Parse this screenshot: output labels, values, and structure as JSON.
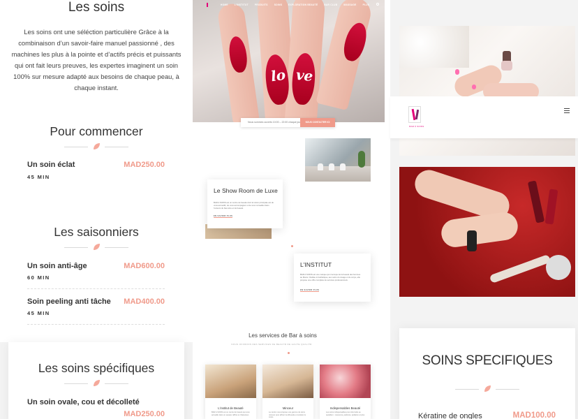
{
  "left": {
    "title": "Les soins",
    "intro": "Les soins ont une séléction particulière Grâce à la combinaison d’un savoir-faire manuel passionné , des machines les plus à la pointe et d’actifs précis et puissants qui ont fait leurs preuves, les expertes imaginent un soin 100% sur mesure adapté aux besoins de chaque peau, à chaque instant.",
    "sections": [
      {
        "title": "Pour commencer",
        "items": [
          {
            "name": "Un soin éclat",
            "price": "MAD250.00",
            "duration": "45 MIN"
          }
        ]
      },
      {
        "title": "Les saisonniers",
        "items": [
          {
            "name": "Un soin anti-âge",
            "price": "MAD600.00",
            "duration": "60 MIN"
          },
          {
            "name": "Soin peeling anti tâche",
            "price": "MAD400.00",
            "duration": "45 MIN"
          }
        ]
      },
      {
        "title": "Les soins spécifiques",
        "items": [
          {
            "name": "Un soin ovale, cou et décolleté",
            "price": "MAD250.00"
          }
        ]
      }
    ]
  },
  "middle": {
    "nav": [
      "HOME",
      "L'INSTITUT",
      "PRODUITS",
      "SOINS",
      "EXPLORATION BEAUTÉ",
      "BAR CLUB",
      "MASSAGE",
      "PLUS"
    ],
    "hero_nail_text": [
      "lo",
      "ve"
    ],
    "hours_text": "Nous sommes ouverts 10:00 – 22:00 chaque jour",
    "hours_button": "NOUS CONTACTER ICI",
    "card1": {
      "title": "Le Show Room de Luxe",
      "body": "BAR A SOINS est un centre de beauté dont la vision principale est de vous accueillir, de vous accompagner et de vous conseiller dans l'univers du bien-être et de beauté.",
      "more": "EN SAVOIR PLUS"
    },
    "card2": {
      "title": "L'INSTITUT",
      "body": "BAR A SOINS est une marque qui s'occupe de la beauté des femmes au Maroc. Dédiée à l'esthétique, aux soins du visage et du corps, elle propose une offre complète de services professionnels.",
      "more": "EN SAVOIR PLUS"
    },
    "services_title": "Les services de Bar à soins",
    "services_sub": "NOUS OFFRONS DES SERVICES DE BEAUTÉ DE HAUTE QUALITÉ",
    "services": [
      {
        "name": "L'institut de Beauté",
        "desc": "BAR A SOINS est un centre de beauté qui vous accueille dans un espace raffiné et chaleureux."
      },
      {
        "name": "Minceur",
        "desc": "Le centre vous propose une gamme de soins minceur pour affiner la silhouette et sculpter le corps."
      },
      {
        "name": "Indispensables Beauté",
        "desc": "Les soins indispensables pour être belle au quotidien : manucure, pédicure, épilation et plus."
      }
    ]
  },
  "right": {
    "logo_caption": "BAR À SOINS",
    "card_title": "SOINS SPECIFIQUES",
    "item_name": "Kératine de ongles",
    "item_price": "MAD100.00"
  },
  "colors": {
    "accent": "#f09a8a",
    "brand_pink": "#e3007a",
    "nail_red": "#c8102e"
  }
}
